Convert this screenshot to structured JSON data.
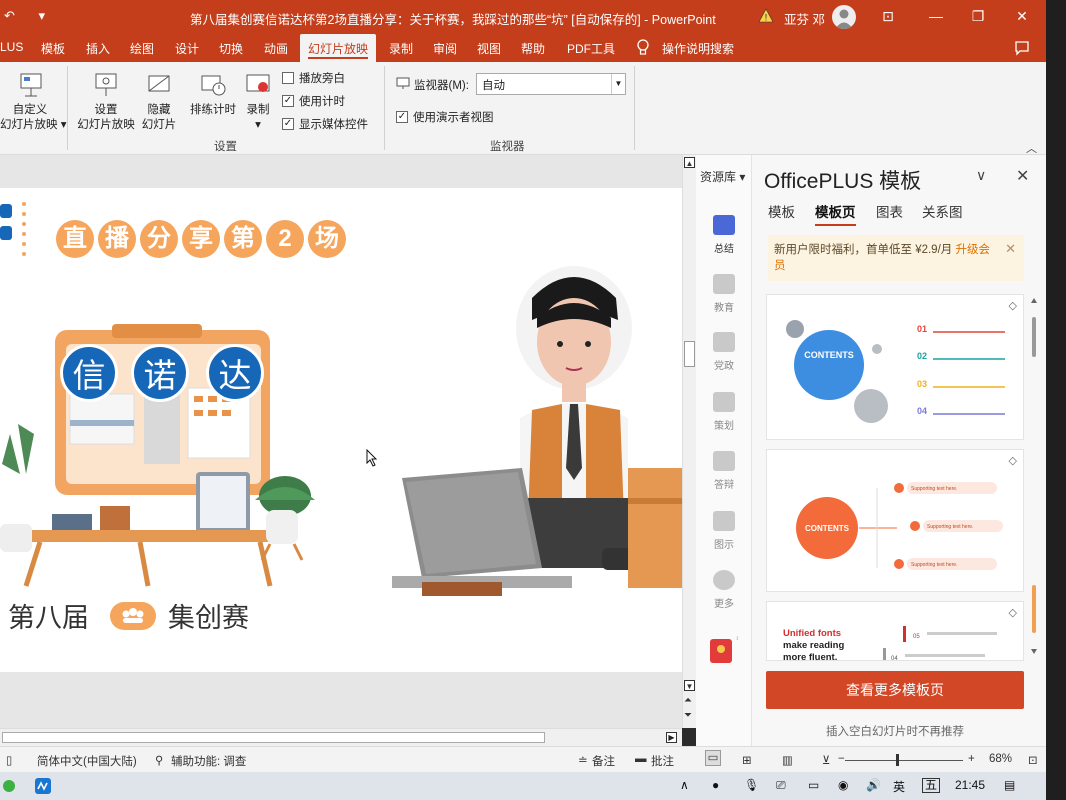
{
  "titlebar": {
    "qat": "↶ ▾",
    "title": "第八届集创赛信诺达杯第2场直播分享：关于杯赛，我踩过的那些“坑” [自动保存的] - PowerPoint",
    "user": "亚芬 邓",
    "min": "—",
    "restore": "❐",
    "close": "✕",
    "ribbon_display": "⊡"
  },
  "tabs": [
    "LUS",
    "模板",
    "插入",
    "绘图",
    "设计",
    "切换",
    "动画",
    "幻灯片放映",
    "录制",
    "审阅",
    "视图",
    "帮助",
    "PDF工具"
  ],
  "tab_active": "幻灯片放映",
  "tell_me": "操作说明搜索",
  "ribbon": {
    "custom_show": "自定义\n幻灯片放映 ▾",
    "setup_show": "设置\n幻灯片放映",
    "hide_slide": "隐藏\n幻灯片",
    "rehearse": "排练计时",
    "record": "录制\n▾",
    "chk_narration": "播放旁白",
    "chk_timing": "使用计时",
    "chk_media": "显示媒体控件",
    "group_setup": "设置",
    "monitor_label": "监视器(M):",
    "monitor_value": "自动",
    "chk_presenter": "使用演示者视图",
    "group_monitor": "监视器"
  },
  "slide": {
    "live_title_chars": [
      "直",
      "播",
      "分",
      "享",
      "第",
      "2",
      "场"
    ],
    "brand_chars": [
      "信",
      "诺",
      "达"
    ],
    "footer_left": "第八届",
    "footer_right": "集创赛"
  },
  "panel": {
    "resource_lib": "资源库 ▾",
    "categories": [
      "总结",
      "教育",
      "党政",
      "策划",
      "答辩",
      "图示",
      "更多"
    ],
    "title": "OfficePLUS 模板",
    "tabs": [
      "模板",
      "模板页",
      "图表",
      "关系图"
    ],
    "tab_active": "模板页",
    "promo_text": "新用户限时福利，首单低至 ¥2.9/月",
    "promo_link": "升级会员",
    "card1": {
      "contents": "CONTENTS",
      "items": [
        "01",
        "02",
        "03",
        "04"
      ],
      "colors": [
        "#e2473a",
        "#1aa3a3",
        "#f2b21c",
        "#7a7ad8"
      ]
    },
    "card2": {
      "contents": "CONTENTS",
      "items": [
        "Supporting text here.",
        "Supporting text here.",
        "Supporting text here."
      ]
    },
    "card3": {
      "line1": "Unified fonts",
      "line2": "make reading",
      "line3": "more fluent.",
      "n1": "05",
      "n2": "04"
    },
    "more_button": "查看更多模板页",
    "no_recommend": "插入空白幻灯片时不再推荐"
  },
  "statusbar": {
    "language": "简体中文(中国大陆)",
    "accessibility": "辅助功能: 调查",
    "notes": "备注",
    "comments": "批注",
    "zoom": "68%"
  },
  "taskbar": {
    "ime": "英",
    "ime2": "五",
    "time": "21:45"
  }
}
